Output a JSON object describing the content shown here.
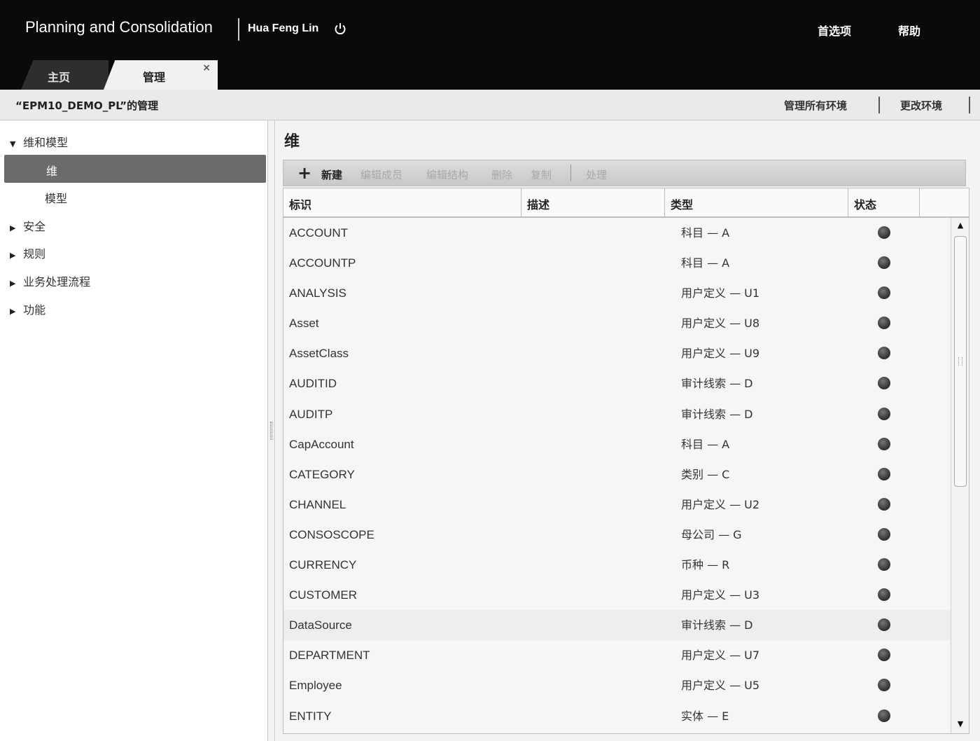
{
  "header": {
    "app_title": "Planning and Consolidation",
    "user": "Hua Feng Lin",
    "preferences": "首选项",
    "help": "帮助",
    "tabs": [
      {
        "label": "主页"
      },
      {
        "label": "管理",
        "close": "×"
      }
    ]
  },
  "subheader": {
    "title": "“EPM10_DEMO_PL”的管理",
    "manage_all": "管理所有环境",
    "change_env": "更改环境"
  },
  "nav": {
    "expanded_group": "维和模型",
    "selected": "维",
    "sub_item": "模型",
    "collapsed": [
      "安全",
      "规则",
      "业务处理流程",
      "功能"
    ],
    "expanded_arrow": "▼",
    "collapsed_arrow": "▶"
  },
  "main": {
    "title": "维",
    "toolbar": {
      "plus": "+",
      "new": "新建",
      "edit_members": "编辑成员",
      "edit_structure": "编辑结构",
      "delete": "删除",
      "copy": "复制",
      "process": "处理"
    },
    "columns": [
      "标识",
      "描述",
      "类型",
      "状态"
    ],
    "rows": [
      {
        "id": "ACCOUNT",
        "type": "科目 — A"
      },
      {
        "id": "ACCOUNTP",
        "type": "科目 — A"
      },
      {
        "id": "ANALYSIS",
        "type": "用户定义 — U1"
      },
      {
        "id": "Asset",
        "type": "用户定义 — U8"
      },
      {
        "id": "AssetClass",
        "type": "用户定义 — U9"
      },
      {
        "id": "AUDITID",
        "type": "审计线索 — D"
      },
      {
        "id": "AUDITP",
        "type": "审计线索 — D"
      },
      {
        "id": "CapAccount",
        "type": "科目 — A"
      },
      {
        "id": "CATEGORY",
        "type": "类别 — C"
      },
      {
        "id": "CHANNEL",
        "type": "用户定义 — U2"
      },
      {
        "id": "CONSOSCOPE",
        "type": "母公司 — G"
      },
      {
        "id": "CURRENCY",
        "type": "币种 — R"
      },
      {
        "id": "CUSTOMER",
        "type": "用户定义 — U3"
      },
      {
        "id": "DataSource",
        "type": "审计线索 — D"
      },
      {
        "id": "DEPARTMENT",
        "type": "用户定义 — U7"
      },
      {
        "id": "Employee",
        "type": "用户定义 — U5"
      },
      {
        "id": "ENTITY",
        "type": "实体 — E"
      }
    ],
    "scroll": {
      "up": "▲",
      "down": "▼"
    }
  }
}
